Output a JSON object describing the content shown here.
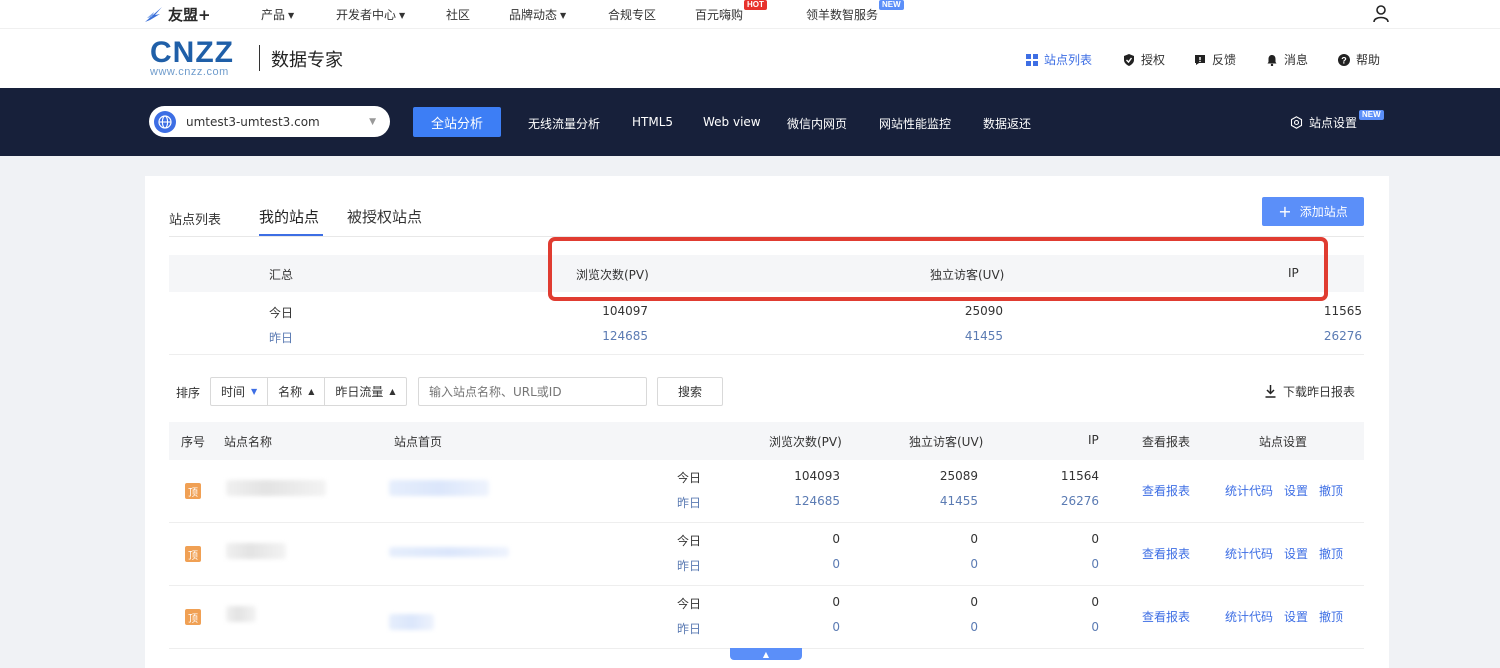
{
  "topnav": {
    "brand": "友盟+",
    "items": [
      {
        "label": "产品",
        "caret": true
      },
      {
        "label": "开发者中心",
        "caret": true
      },
      {
        "label": "社区",
        "caret": false
      },
      {
        "label": "品牌动态",
        "caret": true
      },
      {
        "label": "合规专区",
        "caret": false
      },
      {
        "label": "百元嗨购",
        "caret": false,
        "badge": "HOT"
      },
      {
        "label": "领羊数智服务",
        "caret": false,
        "badge": "NEW"
      }
    ]
  },
  "header": {
    "logo_big": "CNZZ",
    "logo_small": "www.cnzz.com",
    "product": "数据专家",
    "links": [
      "站点列表",
      "授权",
      "反馈",
      "消息",
      "帮助"
    ]
  },
  "navbar": {
    "site": "umtest3-umtest3.com",
    "primary": "全站分析",
    "links": [
      "无线流量分析",
      "HTML5",
      "Web view",
      "微信内网页",
      "网站性能监控",
      "数据返还"
    ],
    "settings": "站点设置",
    "settings_badge": "NEW"
  },
  "tabs": [
    "站点列表",
    "我的站点",
    "被授权站点"
  ],
  "add_site": "添加站点",
  "summary": {
    "headers": [
      "汇总",
      "浏览次数(PV)",
      "独立访客(UV)",
      "IP"
    ],
    "rows": [
      {
        "label": "今日",
        "pv": "104097",
        "uv": "25090",
        "ip": "11565"
      },
      {
        "label": "昨日",
        "pv": "124685",
        "uv": "41455",
        "ip": "26276"
      }
    ]
  },
  "filters": {
    "sort_label": "排序",
    "sorts": [
      "时间",
      "名称",
      "昨日流量"
    ],
    "search_placeholder": "输入站点名称、URL或ID",
    "search_btn": "搜索",
    "download": "下载昨日报表"
  },
  "table": {
    "headers": [
      "序号",
      "站点名称",
      "站点首页",
      "浏览次数(PV)",
      "独立访客(UV)",
      "IP",
      "查看报表",
      "站点设置"
    ],
    "badge": "顶",
    "today": "今日",
    "yesterday": "昨日",
    "actions": {
      "view": "查看报表",
      "code": "统计代码",
      "settings": "设置",
      "untop": "撤顶"
    },
    "rows": [
      {
        "pv_today": "104093",
        "pv_yest": "124685",
        "uv_today": "25089",
        "uv_yest": "41455",
        "ip_today": "11564",
        "ip_yest": "26276"
      },
      {
        "pv_today": "0",
        "pv_yest": "0",
        "uv_today": "0",
        "uv_yest": "0",
        "ip_today": "0",
        "ip_yest": "0"
      },
      {
        "pv_today": "0",
        "pv_yest": "0",
        "uv_today": "0",
        "uv_yest": "0",
        "ip_today": "0",
        "ip_yest": "0"
      }
    ]
  },
  "colors": {
    "accent": "#3d6ee4",
    "navbar": "#17203a",
    "highlight": "#e03c31",
    "badge": "#f0a054"
  }
}
